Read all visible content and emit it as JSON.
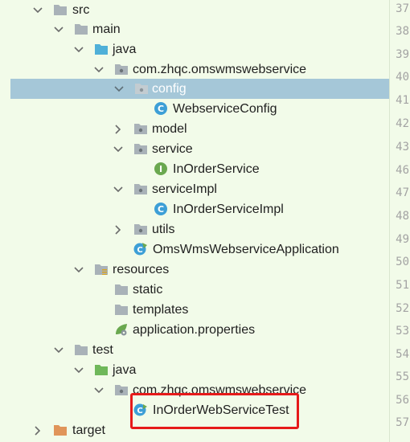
{
  "tree": {
    "src": "src",
    "main": "main",
    "main_java": "java",
    "main_package": "com.zhqc.omswmswebservice",
    "config": "config",
    "webservice_config": "WebserviceConfig",
    "model": "model",
    "service": "service",
    "in_order_service": "InOrderService",
    "service_impl": "serviceImpl",
    "in_order_service_impl": "InOrderServiceImpl",
    "utils": "utils",
    "application_class": "OmsWmsWebserviceApplication",
    "resources": "resources",
    "static": "static",
    "templates": "templates",
    "application_properties": "application.properties",
    "test": "test",
    "test_java": "java",
    "test_package": "com.zhqc.omswmswebservice",
    "test_class": "InOrderWebServiceTest",
    "target": "target"
  },
  "gutter": [
    "37",
    "38",
    "39",
    "40",
    "41",
    "42",
    "43",
    "46",
    "47",
    "48",
    "49",
    "50",
    "51",
    "52",
    "53",
    "54",
    "55",
    "56",
    "57"
  ],
  "colors": {
    "background": "#f2fbe9",
    "selection": "#a5c7d8",
    "folder": "#a9b2b8",
    "source_folder": "#4fb0d8",
    "test_folder": "#6fb85a",
    "class_icon": "#3d9fd6",
    "interface_icon": "#6aa84f",
    "highlight": "#e61a1a"
  }
}
